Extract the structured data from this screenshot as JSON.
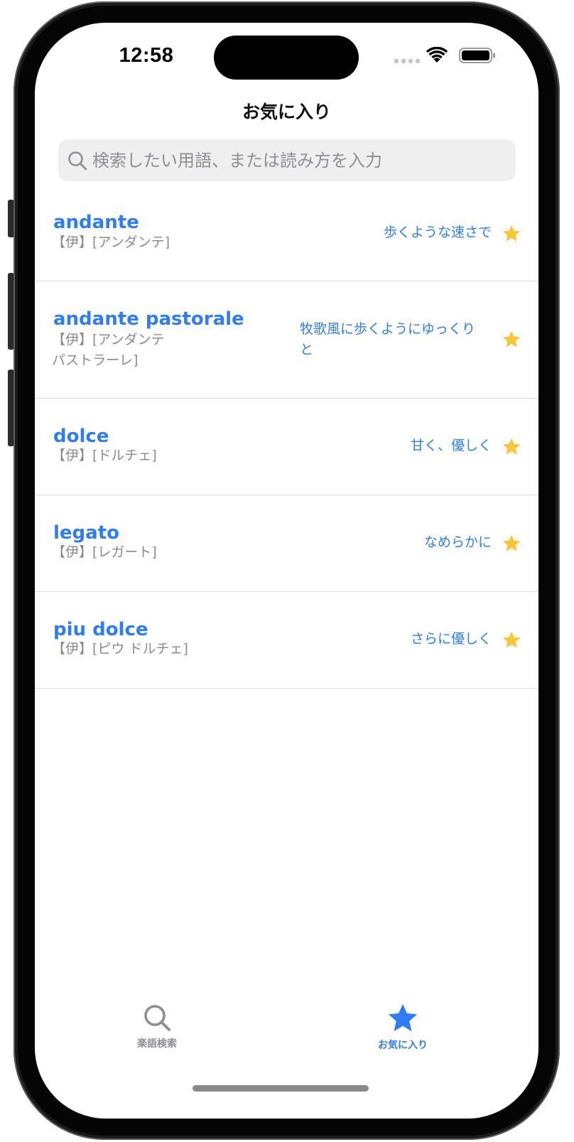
{
  "status_bar": {
    "time": "12:58"
  },
  "header": {
    "title": "お気に入り"
  },
  "search": {
    "placeholder": "検索したい用語、または読み方を入力",
    "value": ""
  },
  "colors": {
    "accent": "#2f7df6",
    "star": "#f6c739",
    "secondary_text": "#8a8a8f"
  },
  "favorites": [
    {
      "term": "andante",
      "reading": "【伊】[アンダンテ]",
      "meaning": "歩くような速さで",
      "favorited": true,
      "icon": "star-icon"
    },
    {
      "term": "andante pastorale",
      "reading": "【伊】[アンダンテ\nパストラーレ]",
      "meaning": "牧歌風に歩くようにゆっくり\nと",
      "favorited": true,
      "icon": "star-icon"
    },
    {
      "term": "dolce",
      "reading": "【伊】[ドルチェ]",
      "meaning": "甘く、優しく",
      "favorited": true,
      "icon": "star-icon"
    },
    {
      "term": "legato",
      "reading": "【伊】[レガート]",
      "meaning": "なめらかに",
      "favorited": true,
      "icon": "star-icon"
    },
    {
      "term": "piu dolce",
      "reading": "【伊】[ピウ ドルチェ]",
      "meaning": "さらに優しく",
      "favorited": true,
      "icon": "star-icon"
    }
  ],
  "tab_bar": {
    "tabs": [
      {
        "label": "楽語検索",
        "icon": "search-icon",
        "selected": false
      },
      {
        "label": "お気に入り",
        "icon": "star-icon",
        "selected": true
      }
    ]
  }
}
